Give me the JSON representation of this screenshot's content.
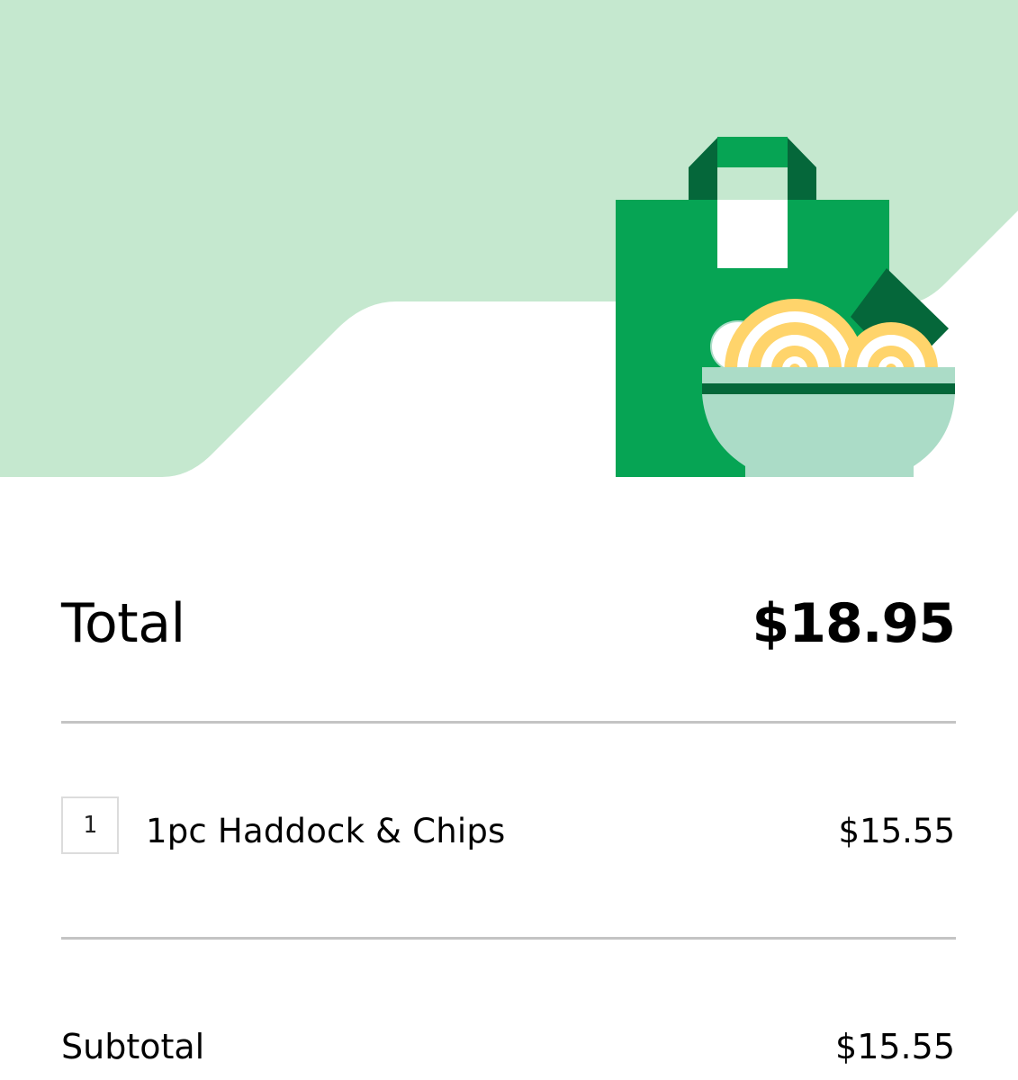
{
  "hero": {
    "illustration": "shopping-bag-with-noodle-bowl",
    "colors": {
      "background_mint": "#c5e8cf",
      "bag_green": "#06a454",
      "bag_dark_green": "#05673a",
      "noodle_yellow": "#ffd46b",
      "bowl_mint": "#abdcc7",
      "egg_orange": "#e9763a"
    }
  },
  "summary": {
    "total_label": "Total",
    "total_value": "$18.95"
  },
  "items": [
    {
      "quantity": "1",
      "name": "1pc Haddock & Chips",
      "price": "$15.55"
    }
  ],
  "subtotal": {
    "label": "Subtotal",
    "value": "$15.55"
  }
}
